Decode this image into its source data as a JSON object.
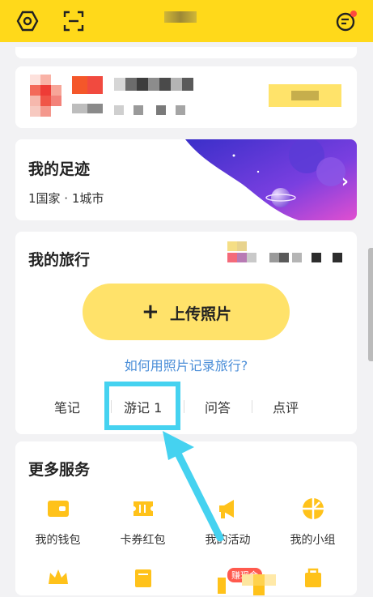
{
  "header": {
    "title": "",
    "icons": [
      "settings-icon",
      "scan-icon",
      "message-icon"
    ],
    "accent": "#ffd91a",
    "notification_dot": "#ff4a3d"
  },
  "footprint": {
    "title": "我的足迹",
    "summary": "1国家 · 1城市",
    "chevron": "›"
  },
  "travel": {
    "title": "我的旅行",
    "upload_plus": "+",
    "upload_label": "上传照片",
    "howto_link": "如何用照片记录旅行?",
    "tabs": [
      "笔记",
      "游记 1",
      "问答",
      "点评"
    ],
    "highlight_color": "#45d2f0"
  },
  "more": {
    "title": "更多服务",
    "services": [
      "我的钱包",
      "卡券红包",
      "我的活动",
      "我的小组"
    ],
    "badge": "赚现金",
    "icon_color": "#ffc21a"
  },
  "link_color": "#4b8ed8"
}
